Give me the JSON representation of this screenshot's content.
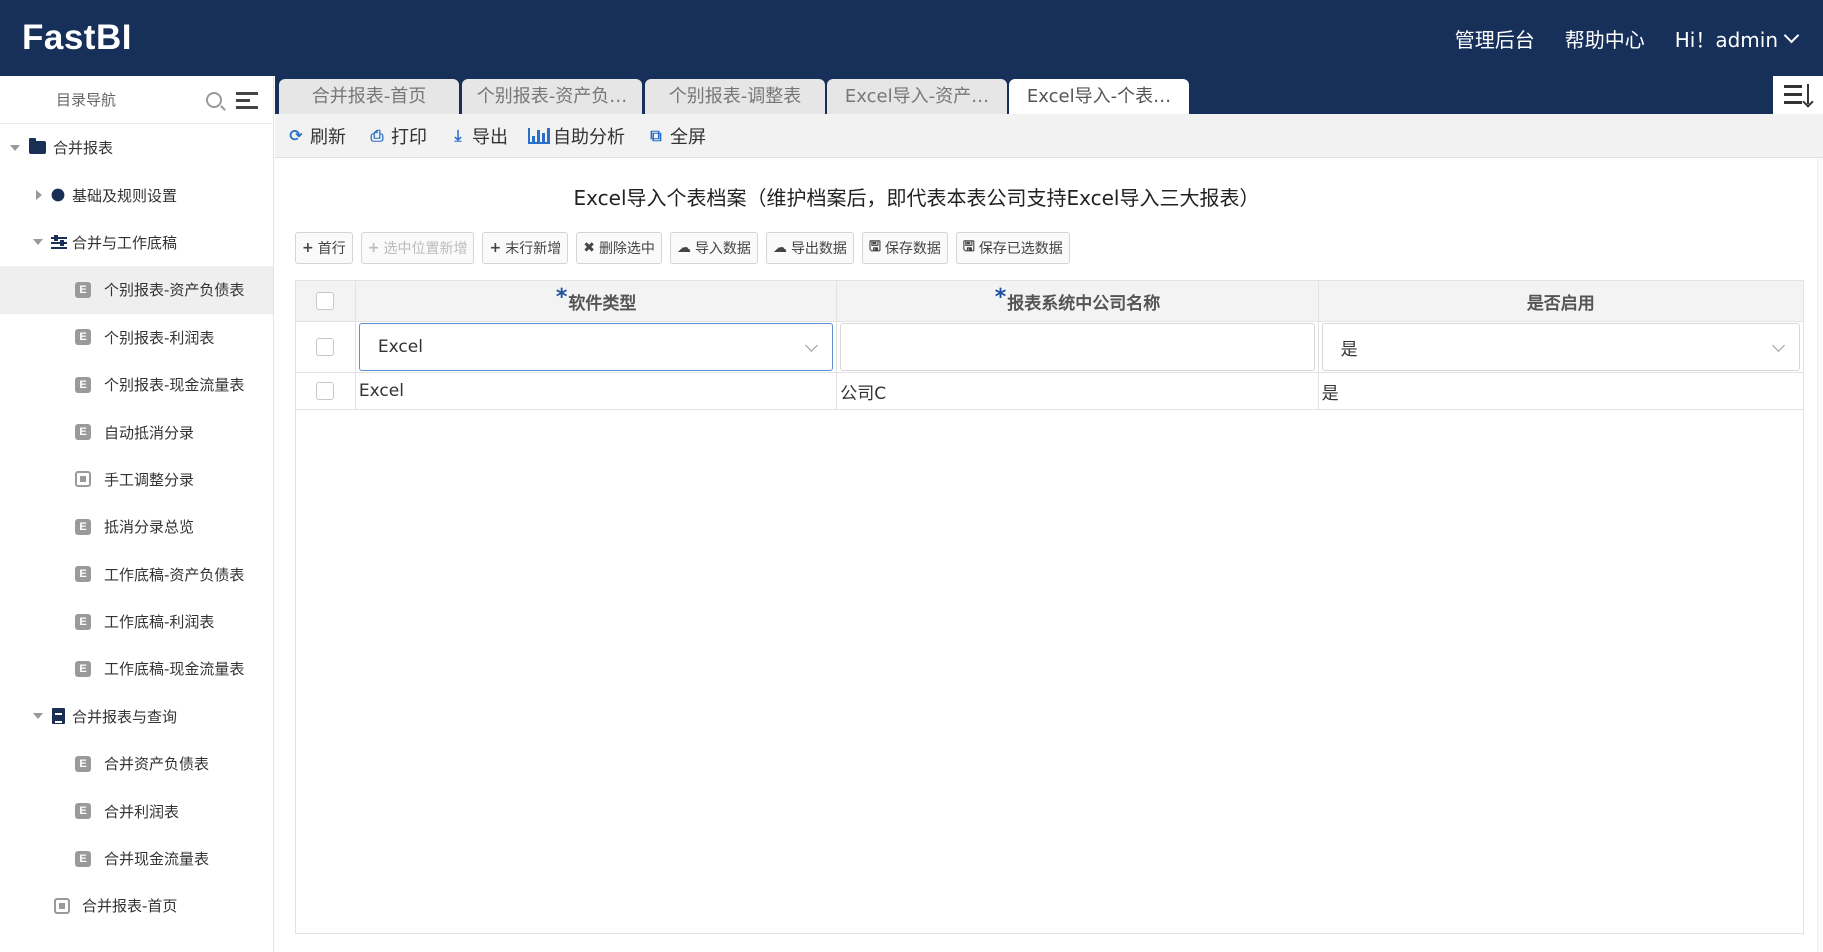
{
  "app": {
    "brand": "FastBI"
  },
  "header": {
    "nav": [
      "管理后台",
      "帮助中心"
    ],
    "user": "Hi！admin"
  },
  "sidebar": {
    "title": "目录导航",
    "items": [
      {
        "label": "合并报表",
        "level": 0,
        "icon": "folder-open-icon",
        "expanded": true
      },
      {
        "label": "基础及规则设置",
        "level": 1,
        "icon": "gear-icon",
        "expanded": false
      },
      {
        "label": "合并与工作底稿",
        "level": 1,
        "icon": "sliders-icon",
        "expanded": true
      },
      {
        "label": "个别报表-资产负债表",
        "level": 2,
        "icon": "excel-file-icon",
        "active": true
      },
      {
        "label": "个别报表-利润表",
        "level": 2,
        "icon": "excel-file-icon"
      },
      {
        "label": "个别报表-现金流量表",
        "level": 2,
        "icon": "excel-file-icon"
      },
      {
        "label": "自动抵消分录",
        "level": 2,
        "icon": "excel-file-icon"
      },
      {
        "label": "手工调整分录",
        "level": 2,
        "icon": "report-icon"
      },
      {
        "label": "抵消分录总览",
        "level": 2,
        "icon": "excel-file-icon"
      },
      {
        "label": "工作底稿-资产负债表",
        "level": 2,
        "icon": "excel-file-icon"
      },
      {
        "label": "工作底稿-利润表",
        "level": 2,
        "icon": "excel-file-icon"
      },
      {
        "label": "工作底稿-现金流量表",
        "level": 2,
        "icon": "excel-file-icon"
      },
      {
        "label": "合并报表与查询",
        "level": 1,
        "icon": "document-icon",
        "expanded": true
      },
      {
        "label": "合并资产负债表",
        "level": 2,
        "icon": "excel-file-icon"
      },
      {
        "label": "合并利润表",
        "level": 2,
        "icon": "excel-file-icon"
      },
      {
        "label": "合并现金流量表",
        "level": 2,
        "icon": "excel-file-icon"
      },
      {
        "label": "合并报表-首页",
        "level": 1,
        "icon": "report-icon"
      }
    ]
  },
  "tabs": [
    {
      "label": "合并报表-首页",
      "active": false
    },
    {
      "label": "个别报表-资产负…",
      "active": false
    },
    {
      "label": "个别报表-调整表",
      "active": false
    },
    {
      "label": "Excel导入-资产…",
      "active": false
    },
    {
      "label": "Excel导入-个表…",
      "active": true
    }
  ],
  "toolbar": {
    "refresh": "刷新",
    "print": "打印",
    "export": "导出",
    "analysis": "自助分析",
    "fullscreen": "全屏"
  },
  "main": {
    "title": "Excel导入个表档案（维护档案后，即代表本表公司支持Excel导入三大报表）",
    "actions": {
      "first_row": "首行",
      "insert_at_selected": "选中位置新增",
      "append_row": "末行新增",
      "delete_selected": "删除选中",
      "import_data": "导入数据",
      "export_data": "导出数据",
      "save_data": "保存数据",
      "save_selected": "保存已选数据"
    },
    "table": {
      "required_mark": "*",
      "columns": [
        "软件类型",
        "报表系统中公司名称",
        "是否启用"
      ],
      "edit_row": {
        "software_type": "Excel",
        "company_name": "",
        "enabled": "是"
      },
      "rows": [
        {
          "software_type": "Excel",
          "company_name": "公司C",
          "enabled": "是"
        }
      ]
    }
  },
  "colors": {
    "header_bg": "#16305a",
    "accent": "#2a6fc9",
    "required": "#1d4f9f"
  }
}
